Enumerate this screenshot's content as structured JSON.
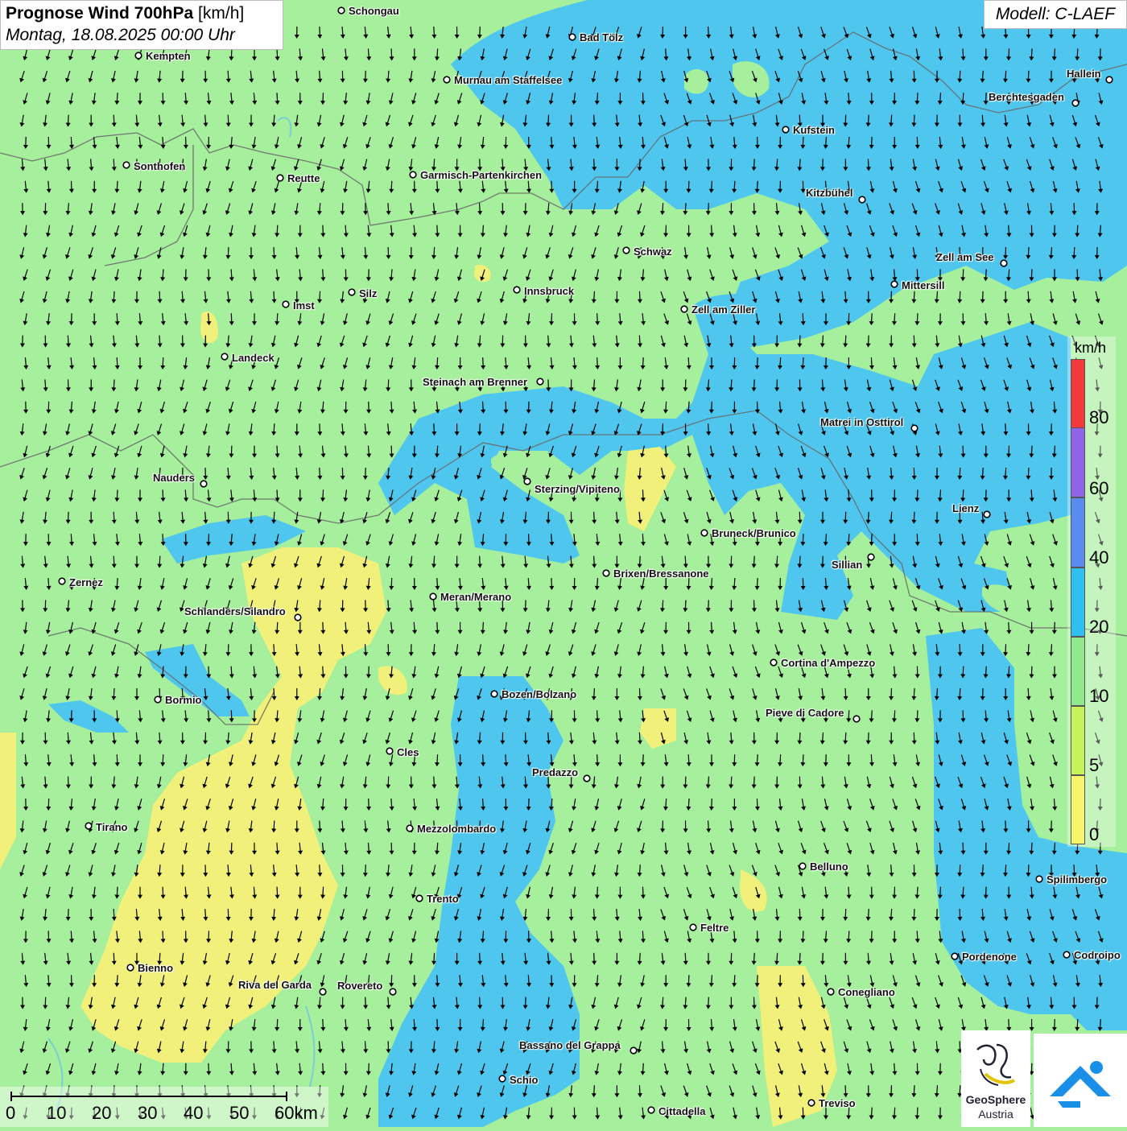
{
  "header": {
    "title_bold": "Prognose Wind 700hPa",
    "title_unit": "[km/h]",
    "date": "Montag, 18.08.2025 00:00 Uhr",
    "model": "Modell: C-LAEF"
  },
  "legend": {
    "unit": "km/h",
    "labels": [
      "80",
      "60",
      "40",
      "20",
      "10",
      "5",
      "0"
    ],
    "colors": [
      "#f23a3a",
      "#8f64e6",
      "#5a8cf0",
      "#2ec0f0",
      "#8eea8c",
      "#c6f25a",
      "#f8f56a"
    ]
  },
  "scalebar": {
    "labels": [
      "0",
      "10",
      "20",
      "30",
      "40",
      "50",
      "60km"
    ]
  },
  "logos": {
    "geosphere_line1": "GeoSphere",
    "geosphere_line2": "Austria"
  },
  "colors": {
    "calm_yellow": "#f4f07a",
    "low_green": "#a6ef9c",
    "moderate_blue": "#4fc6ee",
    "arrow": "#000000"
  },
  "cities": [
    {
      "name": "Schongau"
    },
    {
      "name": "Kempten"
    },
    {
      "name": "Bad Tölz"
    },
    {
      "name": "Hallein"
    },
    {
      "name": "Murnau am Staffelsee"
    },
    {
      "name": "Berchtesgaden"
    },
    {
      "name": "Kufstein"
    },
    {
      "name": "Sonthofen"
    },
    {
      "name": "Reutte"
    },
    {
      "name": "Garmisch-Partenkirchen"
    },
    {
      "name": "Kitzbühel"
    },
    {
      "name": "Schwaz"
    },
    {
      "name": "Zell am See"
    },
    {
      "name": "Innsbruck"
    },
    {
      "name": "Mittersill"
    },
    {
      "name": "Silz"
    },
    {
      "name": "Imst"
    },
    {
      "name": "Zell am Ziller"
    },
    {
      "name": "Landeck"
    },
    {
      "name": "Steinach am Brenner"
    },
    {
      "name": "Matrei in Osttirol"
    },
    {
      "name": "Nauders"
    },
    {
      "name": "Sterzing/Vipiteno"
    },
    {
      "name": "Lienz"
    },
    {
      "name": "Bruneck/Brunico"
    },
    {
      "name": "Sillian"
    },
    {
      "name": "Brixen/Bressanone"
    },
    {
      "name": "Zernez"
    },
    {
      "name": "Meran/Merano"
    },
    {
      "name": "Schlanders/Silandro"
    },
    {
      "name": "Cortina d'Ampezzo"
    },
    {
      "name": "Bozen/Bolzano"
    },
    {
      "name": "Bormio"
    },
    {
      "name": "Pieve di Cadore"
    },
    {
      "name": "Cles"
    },
    {
      "name": "Predazzo"
    },
    {
      "name": "Tirano"
    },
    {
      "name": "Mezzolombardo"
    },
    {
      "name": "Belluno"
    },
    {
      "name": "Spilimbergo"
    },
    {
      "name": "Trento"
    },
    {
      "name": "Feltre"
    },
    {
      "name": "Pordenone"
    },
    {
      "name": "Codroipo"
    },
    {
      "name": "Bienno"
    },
    {
      "name": "Riva del Garda"
    },
    {
      "name": "Rovereto"
    },
    {
      "name": "Conegliano"
    },
    {
      "name": "Bassano del Grappa"
    },
    {
      "name": "Schio"
    },
    {
      "name": "Treviso"
    },
    {
      "name": "Cittadella"
    }
  ]
}
